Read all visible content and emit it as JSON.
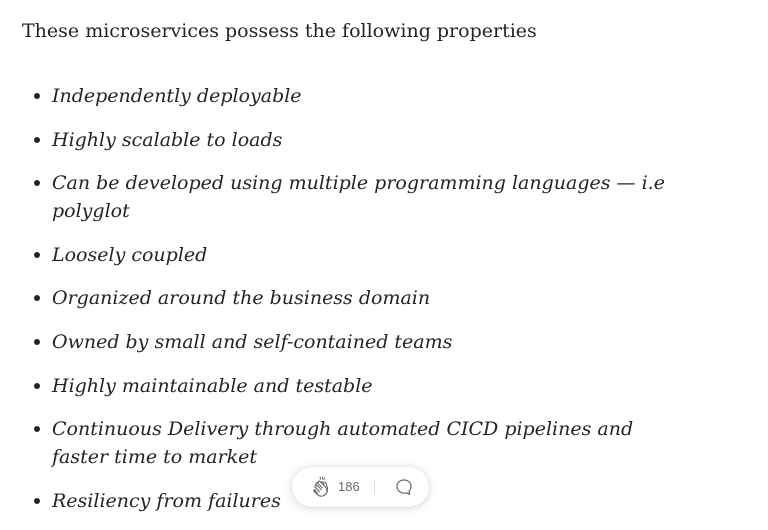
{
  "article": {
    "intro": "These microservices possess the following properties",
    "properties": [
      "Independently deployable",
      "Highly scalable to loads",
      "Can be developed using multiple programming languages — i.e polyglot",
      "Loosely coupled",
      "Organized around the business domain",
      "Owned by small and self-contained teams",
      "Highly maintainable and testable",
      "Continuous Delivery through automated CICD pipelines and faster time to market",
      "Resiliency from failures"
    ]
  },
  "action_bar": {
    "clap_icon": "clap-icon",
    "clap_count": "186",
    "comment_icon": "comment-icon"
  }
}
